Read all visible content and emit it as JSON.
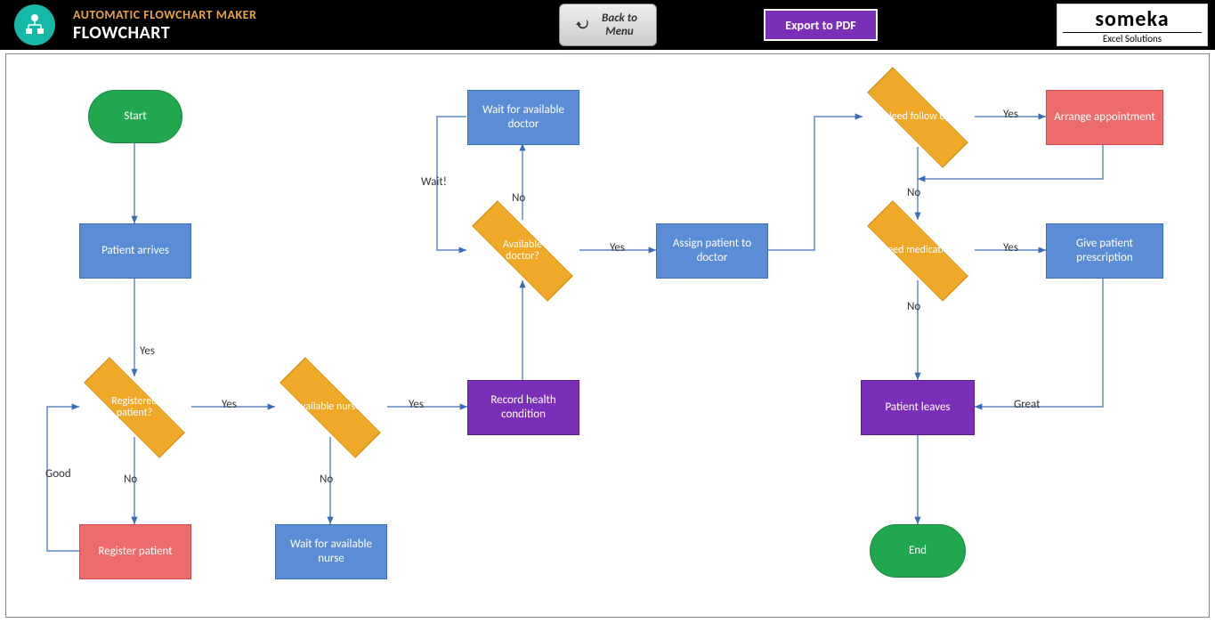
{
  "header": {
    "title": "AUTOMATIC FLOWCHART MAKER",
    "subtitle": "FLOWCHART",
    "back_btn": "Back to Menu",
    "export_btn": "Export to PDF",
    "brand": "someka",
    "brand_sub": "Excel Solutions"
  },
  "nodes": {
    "start": "Start",
    "patient_arrives": "Patient arrives",
    "registered_patient": "Registered patient?",
    "register_patient": "Register patient",
    "available_nurse": "Available nurse?",
    "wait_nurse": "Wait for available nurse",
    "record_health": "Record health condition",
    "available_doctor": "Available doctor?",
    "wait_doctor": "Wait for available doctor",
    "assign_patient": "Assign patient to doctor",
    "need_followup": "Need follow up",
    "arrange_appt": "Arrange appointment",
    "need_medication": "Need medication",
    "give_prescription": "Give patient prescription",
    "patient_leaves": "Patient leaves",
    "end": "End"
  },
  "labels": {
    "yes1": "Yes",
    "no1": "No",
    "good": "Good",
    "yes2": "Yes",
    "no2": "No",
    "yes3": "Yes",
    "no3": "No",
    "wait": "Wait!",
    "yes4": "Yes",
    "no4": "No",
    "yes5": "Yes",
    "no5": "No",
    "yes6": "Yes",
    "great": "Great"
  }
}
